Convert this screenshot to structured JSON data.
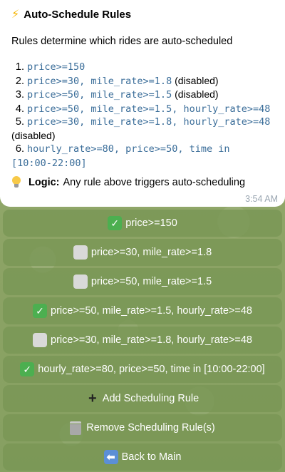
{
  "message": {
    "title_icon": "lightning-icon",
    "title": "Auto-Schedule Rules",
    "description": "Rules determine which rides are auto-scheduled",
    "rules": [
      {
        "num": "1.",
        "code": "price>=150",
        "suffix": ""
      },
      {
        "num": "2.",
        "code": "price>=30, mile_rate>=1.8",
        "suffix": " (disabled)"
      },
      {
        "num": "3.",
        "code": "price>=50, mile_rate>=1.5",
        "suffix": " (disabled)"
      },
      {
        "num": "4.",
        "code": "price>=50, mile_rate>=1.5, hourly_rate>=48",
        "suffix": ""
      },
      {
        "num": "5.",
        "code": "price>=30, mile_rate>=1.8, hourly_rate>=48",
        "suffix": "(disabled)"
      },
      {
        "num": "6.",
        "code": "hourly_rate>=80, price>=50, time in [10:00-22:00]",
        "suffix": ""
      }
    ],
    "logic_label": "Logic:",
    "logic_text": "Any rule above triggers auto-scheduling",
    "time": "3:54 AM"
  },
  "keyboard": {
    "buttons": [
      {
        "icon": "check-icon",
        "label": "price>=150"
      },
      {
        "icon": "empty-box-icon",
        "label": "price>=30, mile_rate>=1.8"
      },
      {
        "icon": "empty-box-icon",
        "label": "price>=50, mile_rate>=1.5"
      },
      {
        "icon": "check-icon",
        "label": "price>=50, mile_rate>=1.5, hourly_rate>=48"
      },
      {
        "icon": "empty-box-icon",
        "label": "price>=30, mile_rate>=1.8, hourly_rate>=48"
      },
      {
        "icon": "check-icon",
        "label": "hourly_rate>=80, price>=50, time in [10:00-22:00]"
      },
      {
        "icon": "plus-icon",
        "label": "Add Scheduling Rule"
      },
      {
        "icon": "trash-icon",
        "label": "Remove Scheduling Rule(s)"
      },
      {
        "icon": "back-icon",
        "label": "Back to Main"
      }
    ]
  },
  "colors": {
    "code_text": "#3a6d99",
    "keyboard_button": "#7a9655",
    "check": "#4caf50"
  }
}
